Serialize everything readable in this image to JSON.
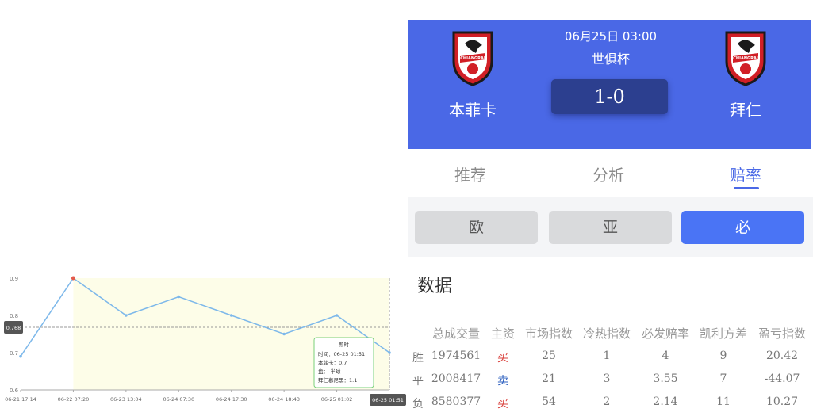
{
  "chart_data": {
    "type": "line",
    "x": [
      "06-21 17:14",
      "06-22 07:20",
      "06-23 13:04",
      "06-24 07:30",
      "06-24 17:30",
      "06-24 18:43",
      "06-25 01:02",
      "06-25 01:51"
    ],
    "y": [
      0.69,
      0.9,
      0.8,
      0.85,
      0.8,
      0.75,
      0.8,
      0.7
    ],
    "ylim": [
      0.6,
      0.9
    ],
    "yticks": [
      "0.9",
      "0.8",
      "0.7",
      "0.6"
    ],
    "crosshair_label": "0.768",
    "active_x_label": "06-25 01:51",
    "tooltip": {
      "title": "即时",
      "lines": [
        "时间：06-25 01:51",
        "本菲卡：0.7",
        "盘：-半球",
        "拜仁慕尼黑：1.1"
      ]
    },
    "colors": {
      "line": "#7db8ea",
      "highlight": "#fdfde8",
      "axis": "#888888"
    }
  },
  "match": {
    "time": "06月25日 03:00",
    "league": "世俱杯",
    "score": "1-0",
    "home": {
      "name": "本菲卡",
      "logo_text": "CHIANGRAI"
    },
    "away": {
      "name": "拜仁",
      "logo_text": "CHIANGRAI"
    }
  },
  "tabs": [
    {
      "label": "推荐"
    },
    {
      "label": "分析"
    },
    {
      "label": "赔率",
      "active": true
    }
  ],
  "subtabs": [
    {
      "label": "欧"
    },
    {
      "label": "亚"
    },
    {
      "label": "必",
      "active": true
    }
  ],
  "section_title": "数据",
  "table": {
    "headers": [
      "总成交量",
      "主资",
      "市场指数",
      "冷热指数",
      "必发赔率",
      "凯利方差",
      "盈亏指数"
    ],
    "rows": [
      {
        "label": "胜",
        "volume": "1974561",
        "fund": "买",
        "market": "25",
        "heat": "1",
        "odds": "4",
        "kelly": "9",
        "pl": "20.42"
      },
      {
        "label": "平",
        "volume": "2008417",
        "fund": "卖",
        "market": "21",
        "heat": "3",
        "odds": "3.55",
        "kelly": "7",
        "pl": "-44.07"
      },
      {
        "label": "负",
        "volume": "8580377",
        "fund": "买",
        "market": "54",
        "heat": "2",
        "odds": "2.14",
        "kelly": "11",
        "pl": "10.27"
      }
    ]
  },
  "colors": {
    "header_bg": "#4a68e6",
    "score_bg": "#2c3f8f",
    "accent": "#4a74f5",
    "buy": "#d9413c",
    "sell": "#2c5fbf"
  }
}
